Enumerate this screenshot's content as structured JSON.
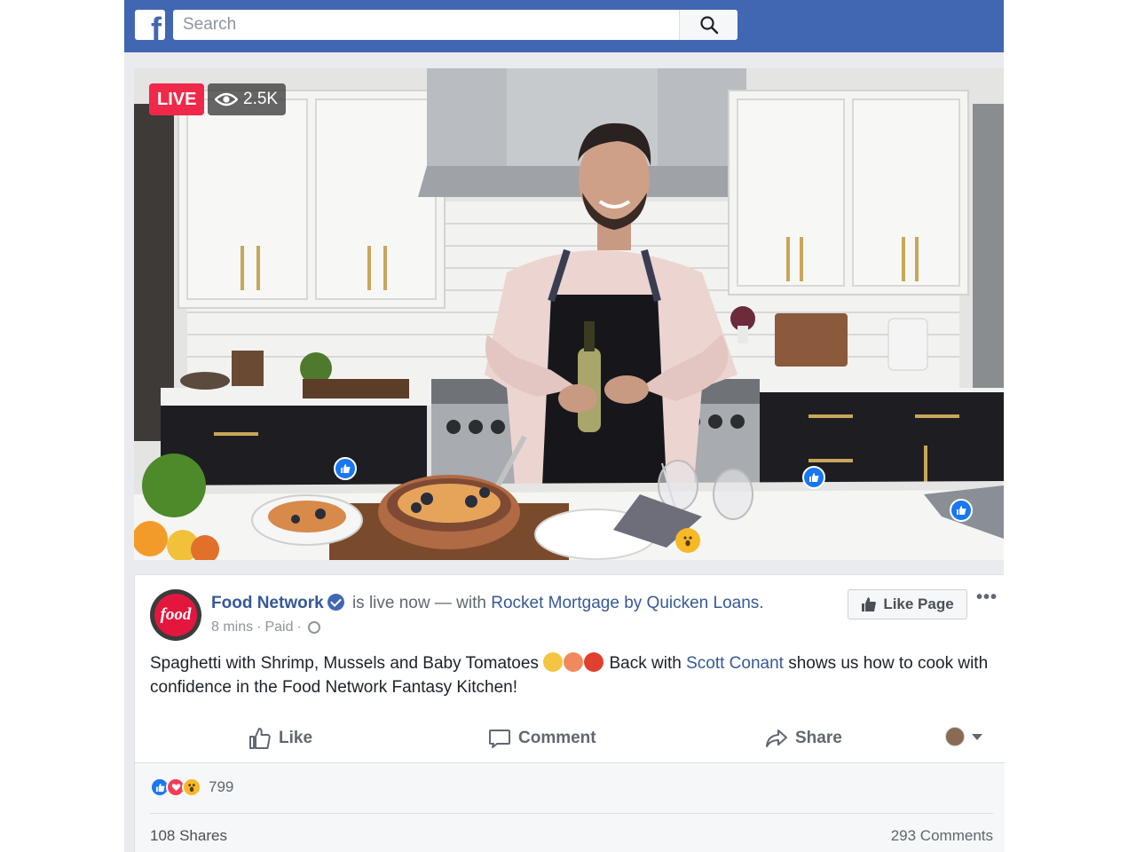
{
  "app": {
    "logo_letter": "f",
    "search": {
      "placeholder": "Search"
    }
  },
  "video": {
    "live_label": "LIVE",
    "viewer_count": "2.5K"
  },
  "post": {
    "page_name": "Food Network",
    "avatar_text": "food",
    "status_text": "is live now — with",
    "tagged_page": "Rocket Mortgage by Quicken Loans.",
    "time": "8 mins",
    "separator": "·",
    "sponsored": "Paid",
    "like_page_label": "Like Page",
    "more_label": "•••",
    "text_part1": "Spaghetti with Shrimp, Mussels and Baby Tomatoes",
    "text_part2": "Back with",
    "mention": "Scott Conant",
    "text_part3": "shows us how to cook with confidence in the Food Network Fantasy Kitchen!"
  },
  "actions": {
    "like": "Like",
    "comment": "Comment",
    "share": "Share"
  },
  "stats": {
    "reaction_count": "799",
    "shares": "108 Shares",
    "comments": "293 Comments"
  },
  "colors": {
    "brand_blue": "#4267b2",
    "link_blue": "#365899",
    "live_red": "#f02849",
    "like_blue": "#1877f2",
    "love_red": "#f33e58",
    "wow_yellow": "#f7b928"
  }
}
